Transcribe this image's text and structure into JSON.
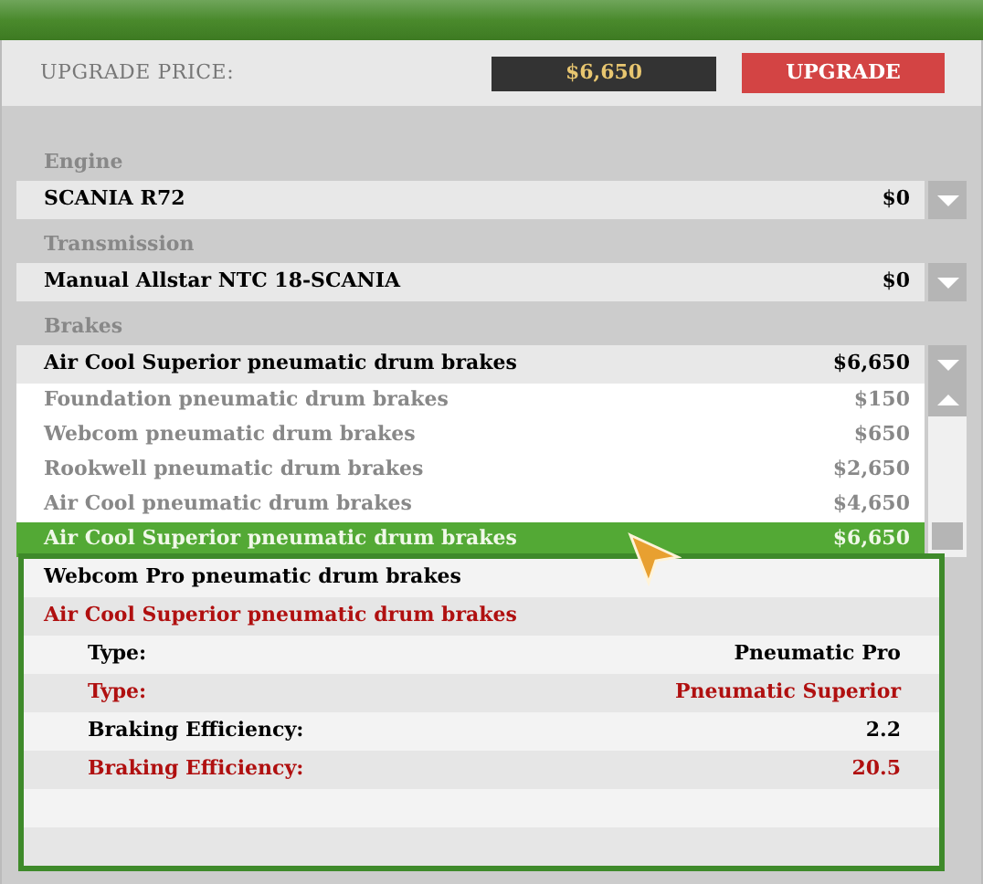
{
  "upgrade": {
    "label": "UPGRADE PRICE:",
    "price": "$6,650",
    "button": "UPGRADE"
  },
  "parts": [
    {
      "label": "Engine",
      "value": "SCANIA R72",
      "price": "$0"
    },
    {
      "label": "Transmission",
      "value": "Manual Allstar NTC 18-SCANIA",
      "price": "$0"
    },
    {
      "label": "Brakes",
      "value": "Air Cool Superior pneumatic drum brakes",
      "price": "$6,650",
      "options": [
        {
          "name": "Foundation pneumatic drum brakes",
          "price": "$150",
          "selected": false
        },
        {
          "name": "Webcom pneumatic drum brakes",
          "price": "$650",
          "selected": false
        },
        {
          "name": "Rookwell pneumatic drum brakes",
          "price": "$2,650",
          "selected": false
        },
        {
          "name": "Air Cool pneumatic drum brakes",
          "price": "$4,650",
          "selected": false
        },
        {
          "name": "Air Cool Superior pneumatic drum brakes",
          "price": "$6,650",
          "selected": true
        }
      ]
    }
  ],
  "tooltip": {
    "rows": [
      {
        "kind": "title",
        "color": "#000000",
        "text": "Webcom Pro pneumatic drum brakes"
      },
      {
        "kind": "title",
        "color": "#b01010",
        "text": "Air Cool Superior pneumatic drum brakes"
      },
      {
        "kind": "stat",
        "color": "#000000",
        "label": "Type:",
        "value": "Pneumatic Pro"
      },
      {
        "kind": "stat",
        "color": "#b01010",
        "label": "Type:",
        "value": "Pneumatic Superior"
      },
      {
        "kind": "stat",
        "color": "#000000",
        "label": "Braking Efficiency:",
        "value": "2.2"
      },
      {
        "kind": "stat",
        "color": "#b01010",
        "label": "Braking Efficiency:",
        "value": "20.5"
      }
    ]
  }
}
